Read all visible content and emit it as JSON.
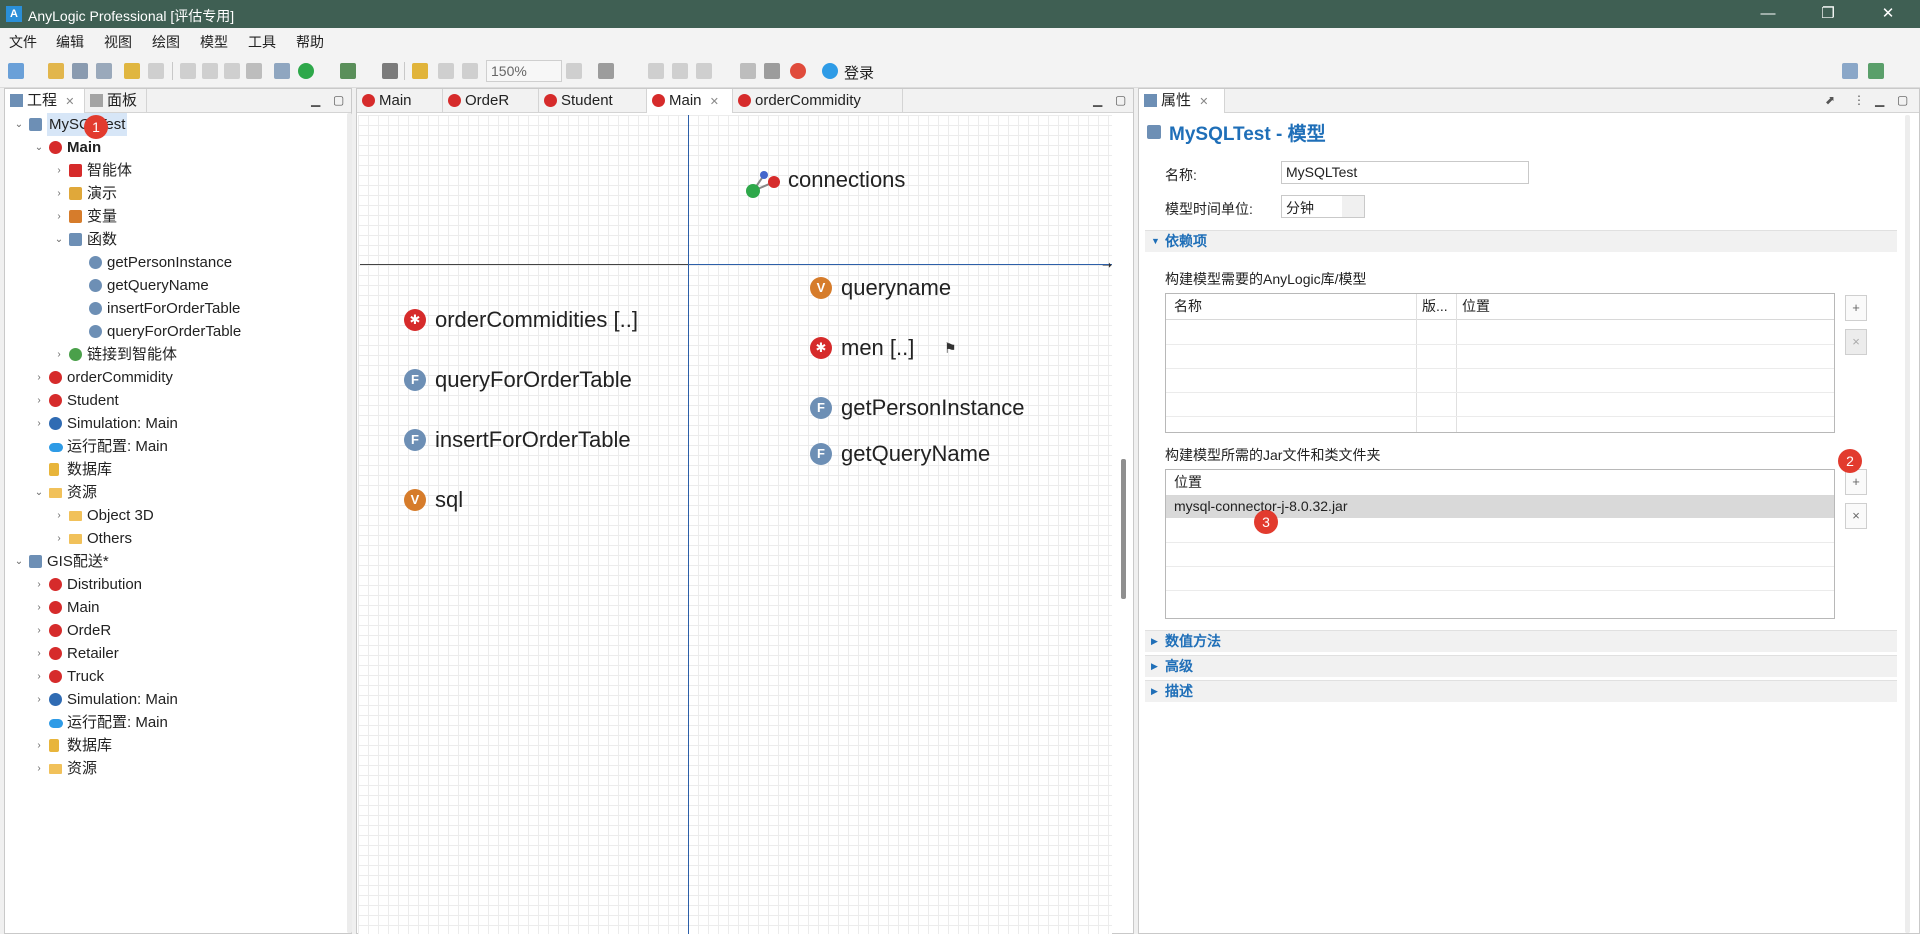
{
  "window": {
    "title": "AnyLogic Professional [评估专用]",
    "app_icon": "A",
    "min": "—",
    "restore": "❐",
    "close": "✕"
  },
  "menu": [
    "文件",
    "编辑",
    "视图",
    "绘图",
    "模型",
    "工具",
    "帮助"
  ],
  "toolbar": {
    "zoom": "150%",
    "login": "登录"
  },
  "left_panel": {
    "tabs": [
      {
        "label": "工程"
      },
      {
        "label": "面板"
      }
    ],
    "tree": [
      {
        "label": "MySQLTest",
        "indent": 0,
        "chev": "v",
        "icon": "model"
      },
      {
        "label": "Main",
        "indent": 1,
        "chev": "v",
        "icon": "agent",
        "bold": true
      },
      {
        "label": "智能体",
        "indent": 2,
        "chev": ">",
        "icon": "agents"
      },
      {
        "label": "演示",
        "indent": 2,
        "chev": ">",
        "icon": "presentation"
      },
      {
        "label": "变量",
        "indent": 2,
        "chev": ">",
        "icon": "variables"
      },
      {
        "label": "函数",
        "indent": 2,
        "chev": "v",
        "icon": "functions"
      },
      {
        "label": "getPersonInstance",
        "indent": 3,
        "chev": "",
        "icon": "function"
      },
      {
        "label": "getQueryName",
        "indent": 3,
        "chev": "",
        "icon": "function"
      },
      {
        "label": "insertForOrderTable",
        "indent": 3,
        "chev": "",
        "icon": "function"
      },
      {
        "label": "queryForOrderTable",
        "indent": 3,
        "chev": "",
        "icon": "function"
      },
      {
        "label": "链接到智能体",
        "indent": 2,
        "chev": ">",
        "icon": "links"
      },
      {
        "label": "orderCommidity",
        "indent": 1,
        "chev": ">",
        "icon": "agent"
      },
      {
        "label": "Student",
        "indent": 1,
        "chev": ">",
        "icon": "agent"
      },
      {
        "label": "Simulation: Main",
        "indent": 1,
        "chev": ">",
        "icon": "experiment"
      },
      {
        "label": "运行配置: Main",
        "indent": 1,
        "chev": "",
        "icon": "cloud"
      },
      {
        "label": "数据库",
        "indent": 1,
        "chev": "",
        "icon": "database"
      },
      {
        "label": "资源",
        "indent": 1,
        "chev": "v",
        "icon": "folder"
      },
      {
        "label": "Object 3D",
        "indent": 2,
        "chev": ">",
        "icon": "folder-open"
      },
      {
        "label": "Others",
        "indent": 2,
        "chev": ">",
        "icon": "folder-open"
      },
      {
        "label": "GIS配送*",
        "indent": 0,
        "chev": "v",
        "icon": "model"
      },
      {
        "label": "Distribution",
        "indent": 1,
        "chev": ">",
        "icon": "agent"
      },
      {
        "label": "Main",
        "indent": 1,
        "chev": ">",
        "icon": "agent"
      },
      {
        "label": "OrdeR",
        "indent": 1,
        "chev": ">",
        "icon": "agent"
      },
      {
        "label": "Retailer",
        "indent": 1,
        "chev": ">",
        "icon": "agent"
      },
      {
        "label": "Truck",
        "indent": 1,
        "chev": ">",
        "icon": "agent"
      },
      {
        "label": "Simulation: Main",
        "indent": 1,
        "chev": ">",
        "icon": "experiment"
      },
      {
        "label": "运行配置: Main",
        "indent": 1,
        "chev": "",
        "icon": "cloud"
      },
      {
        "label": "数据库",
        "indent": 1,
        "chev": ">",
        "icon": "database"
      },
      {
        "label": "资源",
        "indent": 1,
        "chev": ">",
        "icon": "folder"
      }
    ]
  },
  "editor": {
    "tabs": [
      {
        "label": "Main"
      },
      {
        "label": "OrdeR"
      },
      {
        "label": "Student"
      },
      {
        "label": "Main"
      },
      {
        "label": "orderCommidity"
      }
    ],
    "items": {
      "connections": "connections",
      "orderCommidities": "orderCommidities [..]",
      "queryForOrderTable": "queryForOrderTable",
      "insertForOrderTable": "insertForOrderTable",
      "sql": "sql",
      "queryname": "queryname",
      "men": "men [..]",
      "getPersonInstance": "getPersonInstance",
      "getQueryName": "getQueryName"
    },
    "icon_letters": {
      "function": "F",
      "variable": "V"
    }
  },
  "properties": {
    "tab": "属性",
    "title": "MySQLTest - 模型",
    "name_label": "名称:",
    "name_value": "MySQLTest",
    "time_unit_label": "模型时间单位:",
    "time_unit_value": "分钟",
    "dependencies_section": "依赖项",
    "libs_label": "构建模型需要的AnyLogic库/模型",
    "libs_columns": [
      "名称",
      "版...",
      "位置"
    ],
    "jars_label": "构建模型所需的Jar文件和类文件夹",
    "jars_column": "位置",
    "jar_rows": [
      "mysql-connector-j-8.0.32.jar"
    ],
    "sections": [
      "数值方法",
      "高级",
      "描述"
    ],
    "add_glyph": "+",
    "remove_glyph": "×"
  },
  "badges": [
    "1",
    "2",
    "3"
  ],
  "colors": {
    "titlebar": "#3f5f53",
    "link_blue": "#1f6fb8",
    "badge_red": "#e23b2e",
    "agent_red": "#d62b2b"
  }
}
